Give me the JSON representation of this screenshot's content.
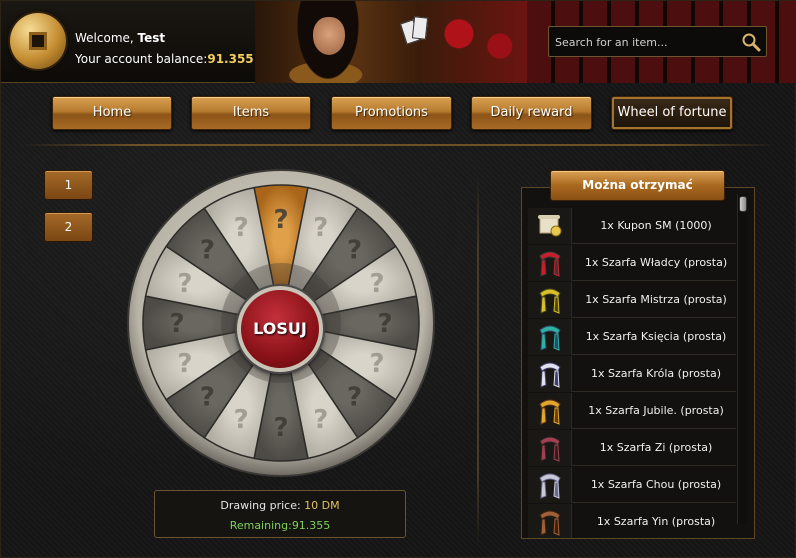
{
  "header": {
    "welcome_prefix": "Welcome,",
    "username": "Test",
    "balance_label": "Your account balance:",
    "balance_value": "91.355",
    "search_placeholder": "Search for an item..."
  },
  "nav": {
    "items": [
      {
        "label": "Home"
      },
      {
        "label": "Items"
      },
      {
        "label": "Promotions"
      },
      {
        "label": "Daily reward"
      },
      {
        "label": "Wheel of fortune",
        "active": true
      }
    ]
  },
  "pages": [
    "1",
    "2"
  ],
  "wheel": {
    "spin_label": "LOSUJ",
    "segments": 16,
    "highlighted_segment": 0,
    "slot_symbol": "?"
  },
  "price": {
    "label": "Drawing price:",
    "amount": "10 DM",
    "remaining_label": "Remaining:",
    "remaining_value": "91.355"
  },
  "rewards": {
    "title": "Można otrzymać",
    "items": [
      {
        "label": "1x Kupon SM (1000)",
        "icon": "coupon-scroll-icon"
      },
      {
        "label": "1x Szarfa Władcy (prosta)",
        "icon": "red-sash-icon"
      },
      {
        "label": "1x Szarfa Mistrza (prosta)",
        "icon": "yellow-sash-icon"
      },
      {
        "label": "1x Szarfa Księcia (prosta)",
        "icon": "teal-sash-icon"
      },
      {
        "label": "1x Szarfa Króla (prosta)",
        "icon": "striped-sash-icon"
      },
      {
        "label": "1x Szarfa Jubile. (prosta)",
        "icon": "gold-sash-icon"
      },
      {
        "label": "1x Szarfa Zi (prosta)",
        "icon": "dark-sash-icon"
      },
      {
        "label": "1x Szarfa Chou (prosta)",
        "icon": "silver-sash-icon"
      },
      {
        "label": "1x Szarfa Yin (prosta)",
        "icon": "brown-sash-icon"
      }
    ]
  },
  "colors": {
    "accent_gold": "#b67b2e",
    "balance": "#f3cf5b",
    "remaining": "#7fd05a",
    "spin_button": "#8a1218"
  }
}
